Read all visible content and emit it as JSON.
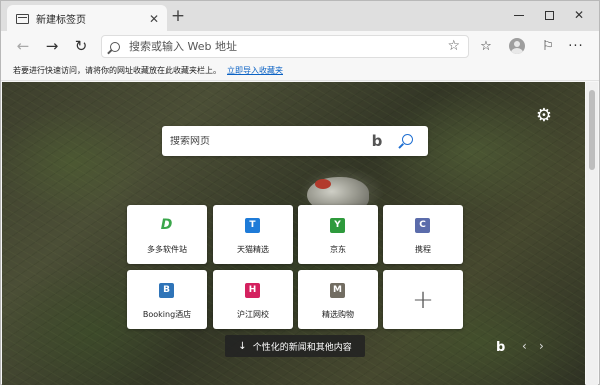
{
  "tab": {
    "title": "新建标签页",
    "close_glyph": "✕",
    "new_tab_glyph": "+"
  },
  "window_controls": {
    "close_glyph": "✕"
  },
  "toolbar": {
    "back_glyph": "←",
    "forward_glyph": "→",
    "reload_glyph": "↻",
    "address_placeholder": "搜索或输入 Web 地址",
    "star_glyph": "☆",
    "favorites_glyph": "☆",
    "feedback_glyph": "⚐",
    "more_glyph": "···"
  },
  "favbar": {
    "message": "若要进行快速访问，请将你的网址收藏放在此收藏夹栏上。",
    "link": "立即导入收藏夹"
  },
  "newtab": {
    "settings_glyph": "⚙",
    "search_placeholder": "搜索网页",
    "bing_glyph": "b",
    "tiles": [
      {
        "label": "多多软件站",
        "letter": "D",
        "color": "#ffffff",
        "icon": "duoduo-logo-icon"
      },
      {
        "label": "天猫精选",
        "letter": "T",
        "color": "#1e7bd8",
        "icon": "tmall-letter-icon"
      },
      {
        "label": "京东",
        "letter": "Y",
        "color": "#2e9a3c",
        "icon": "jd-letter-icon"
      },
      {
        "label": "携程",
        "letter": "C",
        "color": "#5b6cab",
        "icon": "ctrip-letter-icon"
      },
      {
        "label": "Booking酒店",
        "letter": "B",
        "color": "#2f74b8",
        "icon": "booking-letter-icon"
      },
      {
        "label": "沪江网校",
        "letter": "H",
        "color": "#d4215f",
        "icon": "hujiang-letter-icon"
      },
      {
        "label": "精选购物",
        "letter": "M",
        "color": "#726d62",
        "icon": "shopping-letter-icon"
      }
    ],
    "add_glyph": "+",
    "news_button": "个性化的新闻和其他内容",
    "news_arrow": "↓",
    "bing_logo": "b",
    "prev_glyph": "‹",
    "next_glyph": "›"
  }
}
